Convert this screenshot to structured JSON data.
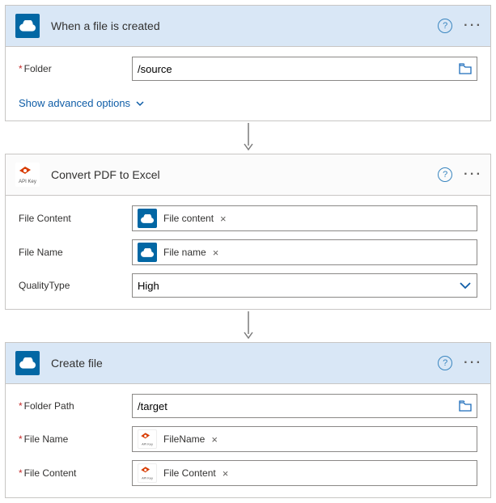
{
  "step1": {
    "title": "When a file is created",
    "folderLabel": "Folder",
    "folderValue": "/source",
    "advOptions": "Show advanced options"
  },
  "step2": {
    "title": "Convert PDF to Excel",
    "apiKeyCaption": "API Key",
    "fileContentLabel": "File Content",
    "fileContentToken": "File content",
    "fileNameLabel": "File Name",
    "fileNameToken": "File name",
    "qualityLabel": "QualityType",
    "qualityValue": "High"
  },
  "step3": {
    "title": "Create file",
    "folderPathLabel": "Folder Path",
    "folderPathValue": "/target",
    "fileNameLabel": "File Name",
    "fileNameToken": "FileName",
    "fileContentLabel": "File Content",
    "fileContentToken": "File Content"
  },
  "glyphs": {
    "x": "×"
  }
}
